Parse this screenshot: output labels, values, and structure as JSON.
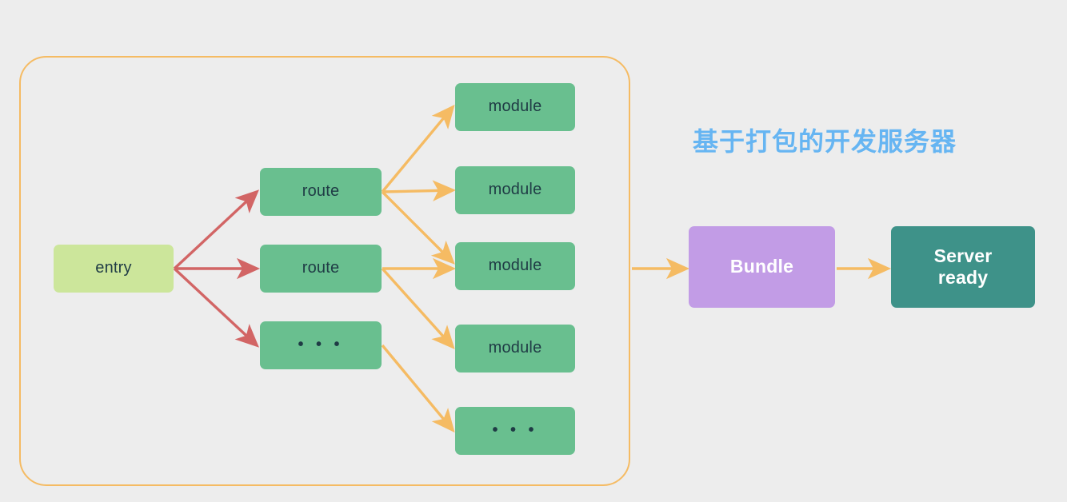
{
  "diagram": {
    "title": "基于打包的开发服务器",
    "title_color": "#66B5F2",
    "background_color": "#EDEDED",
    "group_frame": {
      "name": "bundler-scope",
      "border_color": "#F5BB63"
    },
    "nodes": {
      "entry": {
        "label": "entry",
        "color": "#CCE69B",
        "text_color": "#1F3B45"
      },
      "route_1": {
        "label": "route",
        "color": "#69BF8F",
        "text_color": "#1F3B45"
      },
      "route_2": {
        "label": "route",
        "color": "#69BF8F",
        "text_color": "#1F3B45"
      },
      "route_more": {
        "label": "• • •",
        "color": "#69BF8F",
        "text_color": "#1F3B45"
      },
      "module_1": {
        "label": "module",
        "color": "#69BF8F",
        "text_color": "#1F3B45"
      },
      "module_2": {
        "label": "module",
        "color": "#69BF8F",
        "text_color": "#1F3B45"
      },
      "module_3": {
        "label": "module",
        "color": "#69BF8F",
        "text_color": "#1F3B45"
      },
      "module_4": {
        "label": "module",
        "color": "#69BF8F",
        "text_color": "#1F3B45"
      },
      "module_more": {
        "label": "• • •",
        "color": "#69BF8F",
        "text_color": "#1F3B45"
      },
      "bundle": {
        "label": "Bundle",
        "color": "#C29CE6",
        "text_color": "#FFFFFF"
      },
      "server_ready": {
        "label_line1": "Server",
        "label_line2": "ready",
        "color": "#3E9289",
        "text_color": "#FFFFFF"
      }
    },
    "edges": {
      "entry_color": "#D26565",
      "module_color": "#F5BB63",
      "output_color": "#F5BB63"
    }
  }
}
